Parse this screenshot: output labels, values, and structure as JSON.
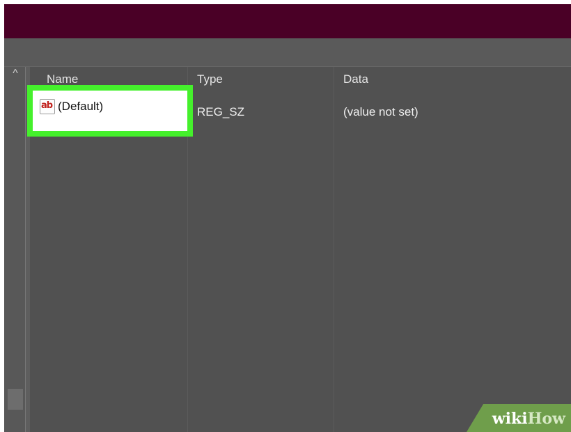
{
  "columns": {
    "name": "Name",
    "type": "Type",
    "data": "Data"
  },
  "rows": [
    {
      "name": "(Default)",
      "type": "REG_SZ",
      "data": "(value not set)",
      "icon": "registry-string-icon"
    }
  ],
  "tree": {
    "scroll_up_glyph": "^"
  },
  "watermark": {
    "wiki": "wiki",
    "how": "How"
  },
  "colors": {
    "titlebar": "#4a0026",
    "highlight": "#45f02c",
    "background": "#535353",
    "icon_red": "#c0201b"
  }
}
